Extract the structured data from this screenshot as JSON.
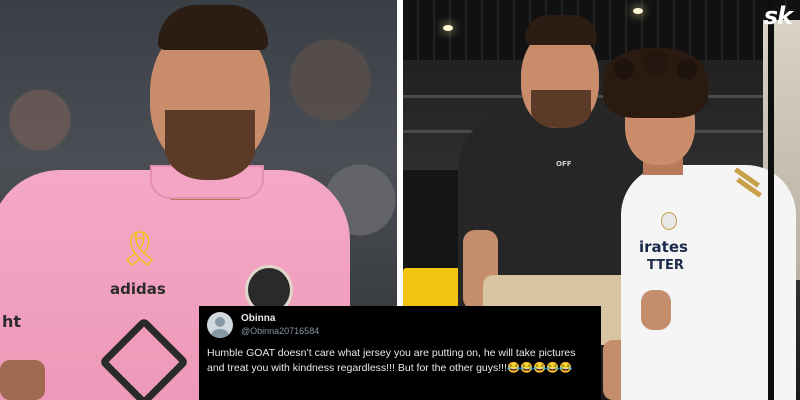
{
  "watermark": {
    "logo_text": "sk"
  },
  "left_photo": {
    "shirt_color": "#f4a8c6",
    "sponsor_text": "adidas",
    "sleeve_text": "ht"
  },
  "right_photo": {
    "tee_text": "OFF",
    "kit_text_line1": "irates",
    "kit_text_line2": "TTER"
  },
  "tweet": {
    "display_name": "Obinna",
    "handle": "@Obinna20716584",
    "text": "Humble GOAT doesn’t care what jersey you are putting on, he will take pictures and treat you with kindness regardless!!! But for the other guys!!!😂😂😂😂😂",
    "background_color": "#000000",
    "text_color": "#e7e9ea"
  }
}
